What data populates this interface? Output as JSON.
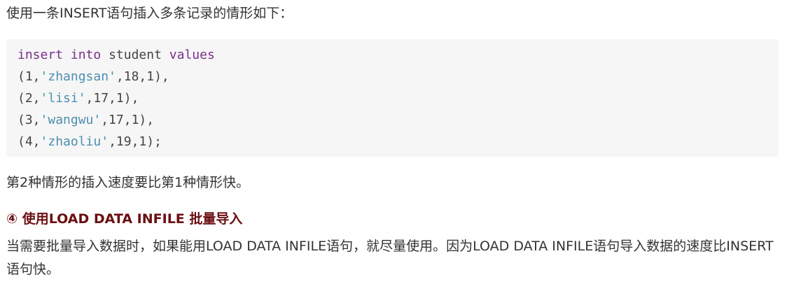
{
  "intro": "使用一条INSERT语句插入多条记录的情形如下：",
  "code": {
    "line1": {
      "kw1": "insert",
      "sp1": " ",
      "kw2": "into",
      "mid": " student ",
      "kw3": "values"
    },
    "rows": [
      {
        "open": "(1,",
        "str": "'zhangsan'",
        "rest": ",18,1),"
      },
      {
        "open": "(2,",
        "str": "'lisi'",
        "rest": ",17,1),"
      },
      {
        "open": "(3,",
        "str": "'wangwu'",
        "rest": ",17,1),"
      },
      {
        "open": "(4,",
        "str": "'zhaoliu'",
        "rest": ",19,1);"
      }
    ]
  },
  "after_code": "第2种情形的插入速度要比第1种情形快。",
  "section_heading": "④ 使用LOAD DATA INFILE 批量导入",
  "section_body": "当需要批量导入数据时，如果能用LOAD DATA INFILE语句，就尽量使用。因为LOAD DATA INFILE语句导入数据的速度比INSERT语句快。"
}
